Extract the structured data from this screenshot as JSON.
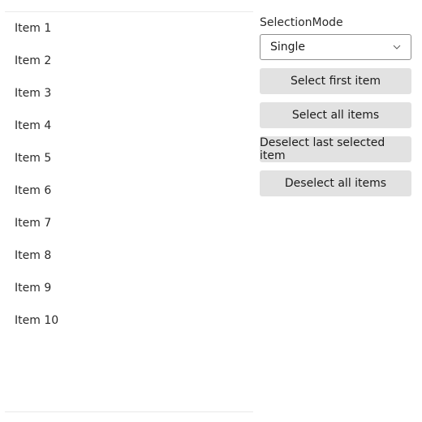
{
  "list": {
    "items": [
      {
        "label": "Item 1"
      },
      {
        "label": "Item 2"
      },
      {
        "label": "Item 3"
      },
      {
        "label": "Item 4"
      },
      {
        "label": "Item 5"
      },
      {
        "label": "Item 6"
      },
      {
        "label": "Item 7"
      },
      {
        "label": "Item 8"
      },
      {
        "label": "Item 9"
      },
      {
        "label": "Item 10"
      }
    ]
  },
  "controls": {
    "selection_mode_label": "SelectionMode",
    "selection_mode_value": "Single",
    "buttons": {
      "select_first": "Select first item",
      "select_all": "Select all items",
      "deselect_last": "Deselect last selected item",
      "deselect_all": "Deselect all items"
    }
  }
}
